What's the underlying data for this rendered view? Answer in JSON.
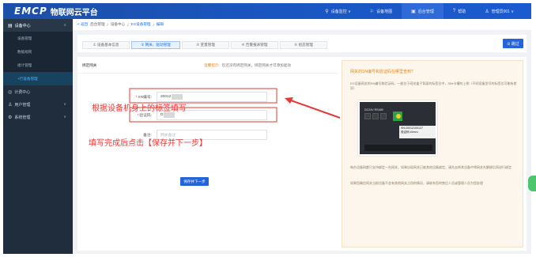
{
  "brand": {
    "logo": "EMCP",
    "name": "物联网云平台"
  },
  "topnav": [
    {
      "icon": "location-icon",
      "glyph": "⚲",
      "label": "设备监控 ∨"
    },
    {
      "icon": "map-icon",
      "glyph": "⚐",
      "label": "设备地图"
    },
    {
      "icon": "admin-icon",
      "glyph": "▣",
      "label": "后台管理"
    },
    {
      "icon": "help-icon",
      "glyph": "?",
      "label": "帮助"
    },
    {
      "icon": "user-icon",
      "glyph": "♙",
      "label": "管理员001 ∨"
    }
  ],
  "sidebar": {
    "top": {
      "label": "设备中心",
      "icon": "device-icon"
    },
    "items": [
      {
        "label": "设备管理"
      },
      {
        "label": "数据规则"
      },
      {
        "label": "组计管理"
      },
      {
        "label": "+行设备管理",
        "active": true
      }
    ],
    "groups": [
      {
        "label": "计费中心",
        "icon": "bill-icon"
      },
      {
        "label": "用户管理",
        "icon": "users-icon"
      },
      {
        "label": "系统管理",
        "icon": "system-icon"
      }
    ]
  },
  "breadcrumb": [
    "< 返回",
    "后台管理",
    "/",
    "设备中心",
    "/",
    "EG设备管理",
    "/",
    "编辑"
  ],
  "steps": [
    {
      "label": "① 设备基本信息"
    },
    {
      "label": "② 网关、驱动管理",
      "active": true
    },
    {
      "label": "③ 变量管理"
    },
    {
      "label": "④ 告警报表管理"
    },
    {
      "label": "⑤ 组态管理"
    }
  ],
  "skip_label": "⊙ 跳过",
  "panel": {
    "tab": "绑定网关",
    "hint_label": "温馨提示:",
    "hint_text": "您还没有绑定网关，绑定网关才可添加驱动",
    "sn_label": "SN编号:",
    "sn_value": "20012",
    "code_label": "验证码:",
    "code_value": "D",
    "remark_label": "备注:",
    "remark_placeholder": "网关备注",
    "save_label": "保存并下一步"
  },
  "annotations": {
    "note1": "根据设备机身上的标签填写",
    "note2": "填写完成后点击【保存并下一步】"
  },
  "help": {
    "title": "网关的SN编号和验证码在哪里查到?",
    "p1": "EG设备网关的SN编号和验证码，一般位于网关盒子背面的标签位中，SIM卡槽的上侧（不同设备型号的标签位可能有差异）",
    "device_label": "DC24V  RS485",
    "sticker_line1": "SN:20012100127",
    "sticker_line2": "验证码:t4mvu",
    "p2": "每台设备网都只支持绑定一台网关，如果出现网关已被其他设备绑定，请先去掉其设备中将网关先解绑后再进行绑定",
    "p3": "如果您确信网关当前设备不会有其他网关占用的情况，请联系您的售后人员或管理人员为您处理"
  }
}
